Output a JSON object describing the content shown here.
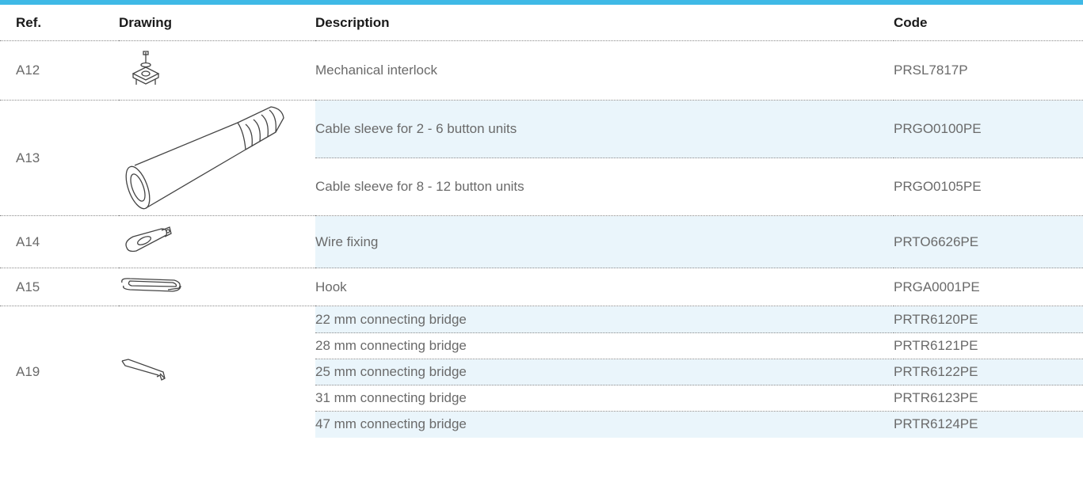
{
  "header": {
    "ref": "Ref.",
    "drawing": "Drawing",
    "description": "Description",
    "code": "Code"
  },
  "groups": [
    {
      "ref": "A12",
      "icon": "mechanical-interlock-icon",
      "items": [
        {
          "description": "Mechanical interlock",
          "code": "PRSL7817P"
        }
      ]
    },
    {
      "ref": "A13",
      "icon": "cable-sleeve-icon",
      "items": [
        {
          "description": "Cable sleeve for 2 - 6 button units",
          "code": "PRGO0100PE"
        },
        {
          "description": "Cable sleeve for 8 - 12 button units",
          "code": "PRGO0105PE"
        }
      ]
    },
    {
      "ref": "A14",
      "icon": "wire-fixing-icon",
      "items": [
        {
          "description": "Wire fixing",
          "code": "PRTO6626PE"
        }
      ]
    },
    {
      "ref": "A15",
      "icon": "hook-icon",
      "items": [
        {
          "description": "Hook",
          "code": "PRGA0001PE"
        }
      ]
    },
    {
      "ref": "A19",
      "icon": "connecting-bridge-icon",
      "items": [
        {
          "description": "22 mm connecting bridge",
          "code": "PRTR6120PE"
        },
        {
          "description": "28 mm connecting bridge",
          "code": "PRTR6121PE"
        },
        {
          "description": "25 mm connecting bridge",
          "code": "PRTR6122PE"
        },
        {
          "description": "31 mm connecting bridge",
          "code": "PRTR6123PE"
        },
        {
          "description": "47 mm connecting bridge",
          "code": "PRTR6124PE"
        }
      ]
    }
  ],
  "colors": {
    "accent": "#3fb9e6",
    "row_highlight": "#eaf5fb"
  }
}
